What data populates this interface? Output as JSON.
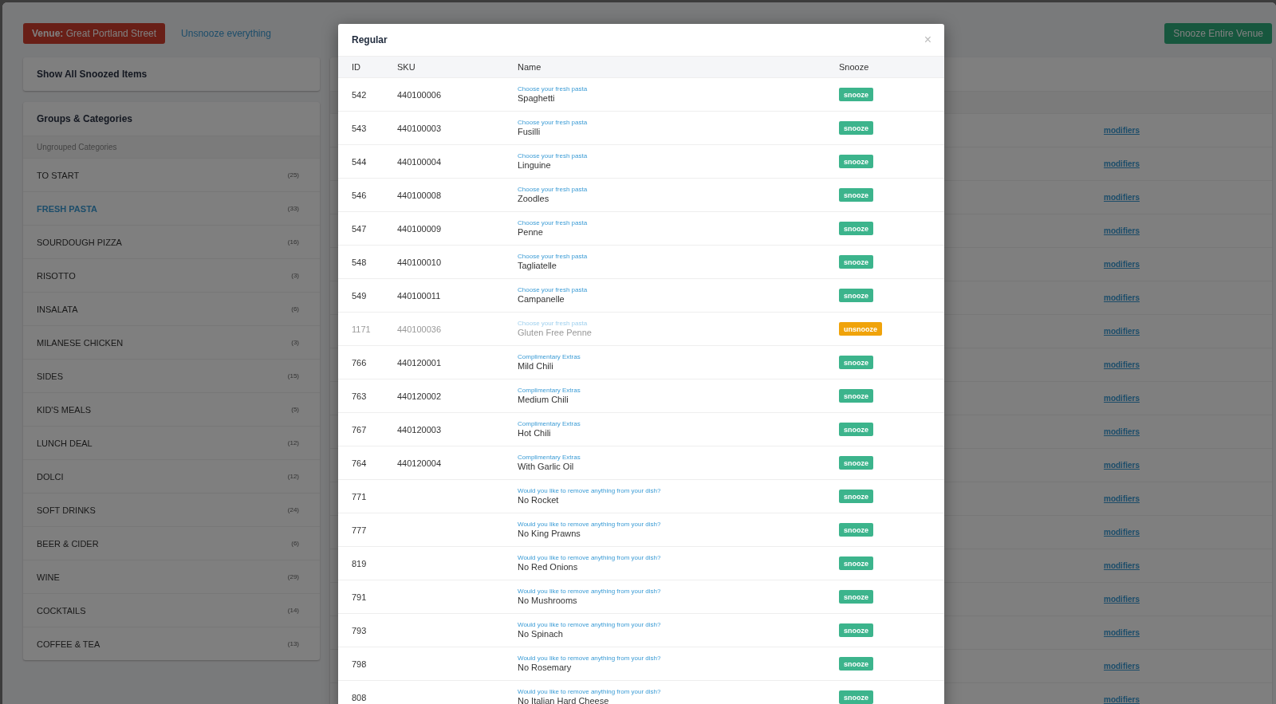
{
  "venue_button": {
    "label": "Venue:",
    "value": "Great Portland Street"
  },
  "unsnooze_all_link": "Unsnooze everything",
  "snooze_venue_button": "Snooze Entire Venue",
  "show_all_card": "Show All Snoozed Items",
  "categories": {
    "title": "Groups & Categories",
    "group_label": "Ungrouped Categories",
    "items": [
      {
        "name": "TO START",
        "count": "(25)",
        "selected": false
      },
      {
        "name": "FRESH PASTA",
        "count": "(33)",
        "selected": true
      },
      {
        "name": "SOURDOUGH PIZZA",
        "count": "(16)",
        "selected": false
      },
      {
        "name": "RISOTTO",
        "count": "(3)",
        "selected": false
      },
      {
        "name": "INSALATA",
        "count": "(6)",
        "selected": false
      },
      {
        "name": "MILANESE CHICKEN",
        "count": "(3)",
        "selected": false
      },
      {
        "name": "SIDES",
        "count": "(15)",
        "selected": false
      },
      {
        "name": "KID'S MEALS",
        "count": "(5)",
        "selected": false
      },
      {
        "name": "LUNCH DEAL",
        "count": "(12)",
        "selected": false
      },
      {
        "name": "DOLCI",
        "count": "(12)",
        "selected": false
      },
      {
        "name": "SOFT DRINKS",
        "count": "(24)",
        "selected": false
      },
      {
        "name": "BEER & CIDER",
        "count": "(6)",
        "selected": false
      },
      {
        "name": "WINE",
        "count": "(29)",
        "selected": false
      },
      {
        "name": "COCKTAILS",
        "count": "(14)",
        "selected": false
      },
      {
        "name": "COFFEE & TEA",
        "count": "(13)",
        "selected": false
      }
    ]
  },
  "right_panel": {
    "rows": [
      {
        "link": "modifiers"
      },
      {
        "link": "modifiers"
      },
      {
        "link": "modifiers"
      },
      {
        "link": "modifiers"
      },
      {
        "link": "modifiers"
      },
      {
        "link": "modifiers"
      },
      {
        "link": "modifiers"
      },
      {
        "link": "modifiers"
      },
      {
        "link": "modifiers"
      },
      {
        "link": "modifiers"
      },
      {
        "link": "modifiers"
      },
      {
        "link": "modifiers"
      },
      {
        "link": "modifiers"
      },
      {
        "link": "modifiers"
      },
      {
        "link": "modifiers"
      },
      {
        "link": "modifiers"
      },
      {
        "link": "modifiers"
      },
      {
        "link": "modifiers"
      }
    ]
  },
  "modal": {
    "title": "Regular",
    "close": "×",
    "columns": [
      "ID",
      "SKU",
      "Name",
      "Snooze"
    ],
    "rows": [
      {
        "id": "542",
        "sku": "440100006",
        "group": "Choose your fresh pasta",
        "name": "Spaghetti",
        "snoozed": false,
        "action": "snooze"
      },
      {
        "id": "543",
        "sku": "440100003",
        "group": "Choose your fresh pasta",
        "name": "Fusilli",
        "snoozed": false,
        "action": "snooze"
      },
      {
        "id": "544",
        "sku": "440100004",
        "group": "Choose your fresh pasta",
        "name": "Linguine",
        "snoozed": false,
        "action": "snooze"
      },
      {
        "id": "546",
        "sku": "440100008",
        "group": "Choose your fresh pasta",
        "name": "Zoodles",
        "snoozed": false,
        "action": "snooze"
      },
      {
        "id": "547",
        "sku": "440100009",
        "group": "Choose your fresh pasta",
        "name": "Penne",
        "snoozed": false,
        "action": "snooze"
      },
      {
        "id": "548",
        "sku": "440100010",
        "group": "Choose your fresh pasta",
        "name": "Tagliatelle",
        "snoozed": false,
        "action": "snooze"
      },
      {
        "id": "549",
        "sku": "440100011",
        "group": "Choose your fresh pasta",
        "name": "Campanelle",
        "snoozed": false,
        "action": "snooze"
      },
      {
        "id": "1171",
        "sku": "440100036",
        "group": "Choose your fresh pasta",
        "name": "Gluten Free Penne",
        "snoozed": true,
        "action": "unsnooze"
      },
      {
        "id": "766",
        "sku": "440120001",
        "group": "Complimentary Extras",
        "name": "Mild Chili",
        "snoozed": false,
        "action": "snooze"
      },
      {
        "id": "763",
        "sku": "440120002",
        "group": "Complimentary Extras",
        "name": "Medium Chili",
        "snoozed": false,
        "action": "snooze"
      },
      {
        "id": "767",
        "sku": "440120003",
        "group": "Complimentary Extras",
        "name": "Hot Chili",
        "snoozed": false,
        "action": "snooze"
      },
      {
        "id": "764",
        "sku": "440120004",
        "group": "Complimentary Extras",
        "name": "With Garlic Oil",
        "snoozed": false,
        "action": "snooze"
      },
      {
        "id": "771",
        "group": "Would you like to remove anything from your dish?",
        "name": "No Rocket",
        "snoozed": false,
        "action": "snooze"
      },
      {
        "id": "777",
        "group": "Would you like to remove anything from your dish?",
        "name": "No King Prawns",
        "snoozed": false,
        "action": "snooze"
      },
      {
        "id": "819",
        "group": "Would you like to remove anything from your dish?",
        "name": "No Red Onions",
        "snoozed": false,
        "action": "snooze"
      },
      {
        "id": "791",
        "group": "Would you like to remove anything from your dish?",
        "name": "No Mushrooms",
        "snoozed": false,
        "action": "snooze"
      },
      {
        "id": "793",
        "group": "Would you like to remove anything from your dish?",
        "name": "No Spinach",
        "snoozed": false,
        "action": "snooze"
      },
      {
        "id": "798",
        "group": "Would you like to remove anything from your dish?",
        "name": "No Rosemary",
        "snoozed": false,
        "action": "snooze"
      },
      {
        "id": "808",
        "group": "Would you like to remove anything from your dish?",
        "name": "No Italian Hard Cheese",
        "snoozed": false,
        "action": "snooze"
      }
    ]
  }
}
